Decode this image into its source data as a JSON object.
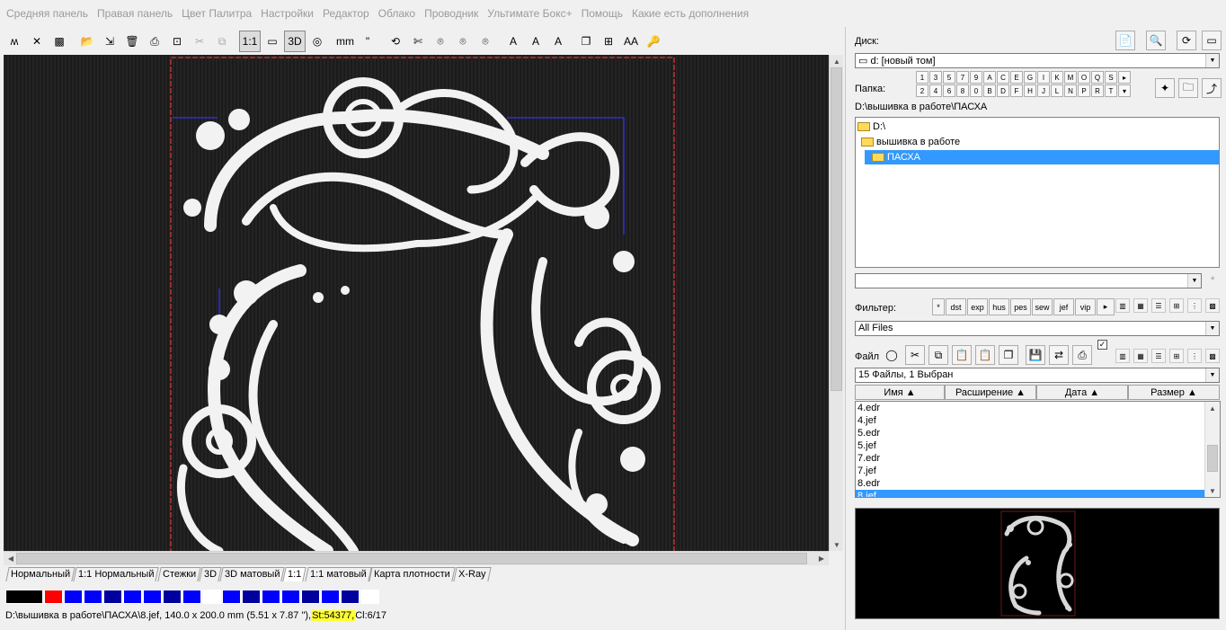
{
  "menu": [
    "Средняя панель",
    "Правая панель",
    "Цвет Палитра",
    "Настройки",
    "Редактор",
    "Облако",
    "Проводник",
    "Ультимате Бокс+",
    "Помощь",
    "Какие есть дополнения"
  ],
  "toolbar": [
    {
      "name": "stitch-tool-icon",
      "glyph": "ʍ"
    },
    {
      "name": "satin-tool-icon",
      "glyph": "✕"
    },
    {
      "name": "fill-tool-icon",
      "glyph": "▩"
    },
    {
      "sep": true
    },
    {
      "name": "open-icon",
      "glyph": "📂"
    },
    {
      "name": "import-icon",
      "glyph": "⇲"
    },
    {
      "name": "delete-icon",
      "glyph": "🗑"
    },
    {
      "name": "print-icon",
      "glyph": "⎙"
    },
    {
      "name": "export-icon",
      "glyph": "⊡"
    },
    {
      "name": "cut-icon",
      "glyph": "✂",
      "grey": true
    },
    {
      "name": "copy-icon",
      "glyph": "⧉",
      "grey": true
    },
    {
      "sep": true
    },
    {
      "name": "view-1to1-icon",
      "glyph": "1:1",
      "pressed": true
    },
    {
      "name": "view-screen-icon",
      "glyph": "▭"
    },
    {
      "name": "view-3d-icon",
      "glyph": "3D",
      "pressed": true
    },
    {
      "name": "view-xray-icon",
      "glyph": "◎"
    },
    {
      "sep": true
    },
    {
      "name": "ruler-mm-icon",
      "glyph": "mm"
    },
    {
      "name": "ruler-inch-icon",
      "glyph": "\""
    },
    {
      "sep": true
    },
    {
      "name": "thread-icon",
      "glyph": "⟲"
    },
    {
      "name": "scissors-icon",
      "glyph": "✄"
    },
    {
      "name": "hoop-icon",
      "glyph": "⌾"
    },
    {
      "name": "hoop-2-icon",
      "glyph": "⌾"
    },
    {
      "name": "hoop-3-icon",
      "glyph": "⌾"
    },
    {
      "sep": true
    },
    {
      "name": "lettering-icon",
      "glyph": "A"
    },
    {
      "name": "lettering-2-icon",
      "glyph": "A"
    },
    {
      "name": "lettering-3-icon",
      "glyph": "A"
    },
    {
      "sep": true
    },
    {
      "name": "pages-icon",
      "glyph": "❐"
    },
    {
      "name": "tree-icon",
      "glyph": "⊞"
    },
    {
      "name": "font-size-icon",
      "glyph": "AA"
    },
    {
      "name": "key-icon",
      "glyph": "🔑"
    }
  ],
  "view_tabs": [
    "Нормальный",
    "1:1 Нормальный",
    "Стежки",
    "3D",
    "3D матовый",
    "1:1",
    "1:1 матовый",
    "Карта плотности",
    "X-Ray"
  ],
  "active_view_tab": 5,
  "palette_colors": [
    "#000000",
    "#ff0000",
    "#0000ff",
    "#0000ff",
    "#00009e",
    "#0000ff",
    "#0000ff",
    "#00009e",
    "#0000ff",
    "#ffffff",
    "#0000ff",
    "#00009e",
    "#0000ff",
    "#0000ff",
    "#00009e",
    "#0000ff",
    "#00009e",
    "#ffffff"
  ],
  "status": {
    "path": "D:\\вышивка  в работе\\ПАСХА\\8.jef, 140.0 x 200.0 mm (5.51 x 7.87 \"), ",
    "stitches": "St:54377,",
    "colors": "Cl:6/17"
  },
  "right": {
    "disk_label": "Диск:",
    "disk_value": "d: [новый том]",
    "folder_label": "Папка:",
    "keys_row1": [
      "1",
      "3",
      "5",
      "7",
      "9",
      "A",
      "C",
      "E",
      "G",
      "I",
      "K",
      "M",
      "O",
      "Q",
      "S",
      "▸"
    ],
    "keys_row2": [
      "2",
      "4",
      "6",
      "8",
      "0",
      "B",
      "D",
      "F",
      "H",
      "J",
      "L",
      "N",
      "P",
      "R",
      "T",
      "▾"
    ],
    "current_path": "D:\\вышивка  в работе\\ПАСХА",
    "tree": [
      {
        "label": "D:\\",
        "indent": 0
      },
      {
        "label": "вышивка  в работе",
        "indent": 1
      },
      {
        "label": "ПАСХА",
        "indent": 2,
        "selected": true
      }
    ],
    "filter_label": "Фильтер:",
    "filter_buttons": [
      "*",
      "dst",
      "exp",
      "hus",
      "pes",
      "sew",
      "jef",
      "vip",
      "▸"
    ],
    "filter_value": "All Files",
    "file_label": "Файл",
    "file_count": "15 Файлы, 1 Выбран",
    "columns": [
      "Имя ▲",
      "Расширение ▲",
      "Дата ▲",
      "Размер ▲"
    ],
    "files": [
      "4.edr",
      "4.jef",
      "5.edr",
      "5.jef",
      "7.edr",
      "7.jef",
      "8.edr",
      "8.jef"
    ],
    "selected_file": 7
  }
}
